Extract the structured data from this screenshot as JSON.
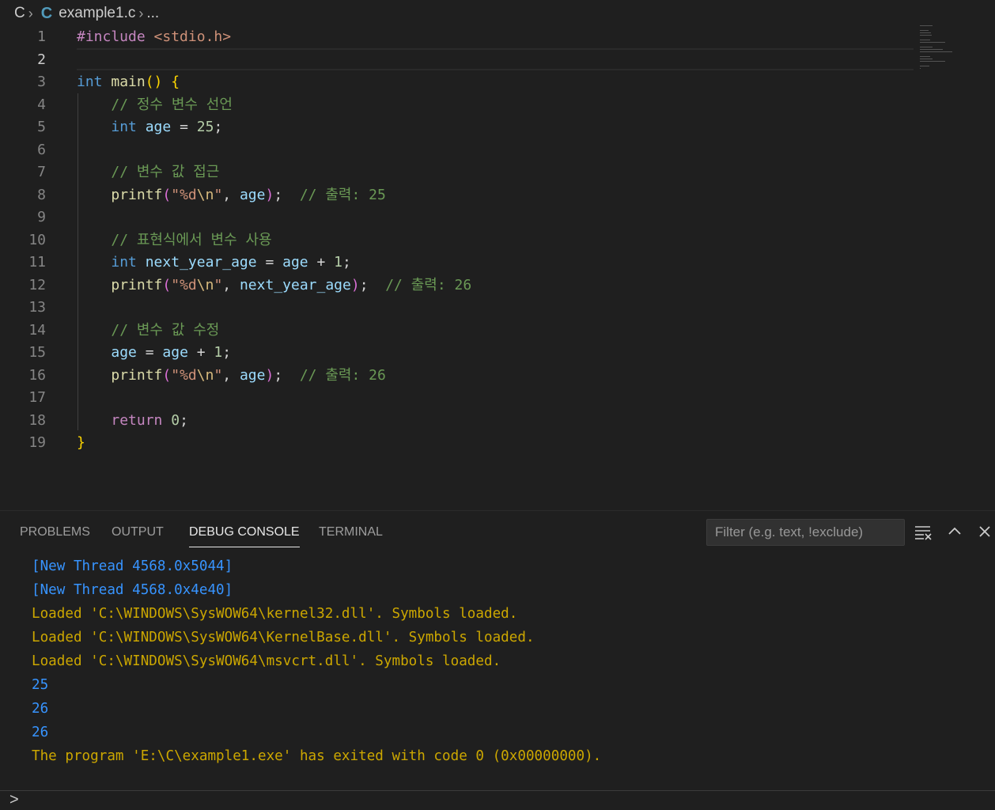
{
  "breadcrumb": {
    "folder": "C",
    "file_icon": "C",
    "file": "example1.c",
    "more": "..."
  },
  "editor": {
    "active_line": 2,
    "lines": [
      {
        "n": "1",
        "tokens": [
          [
            "inc",
            "#include "
          ],
          [
            "hdr",
            "<stdio.h>"
          ]
        ]
      },
      {
        "n": "2",
        "tokens": []
      },
      {
        "n": "3",
        "tokens": [
          [
            "kw",
            "int "
          ],
          [
            "fn",
            "main"
          ],
          [
            "p1",
            "() {"
          ]
        ]
      },
      {
        "n": "4",
        "tokens": [
          [
            "op",
            "    "
          ],
          [
            "cmt",
            "// 정수 변수 선언"
          ]
        ]
      },
      {
        "n": "5",
        "tokens": [
          [
            "op",
            "    "
          ],
          [
            "kw",
            "int "
          ],
          [
            "var",
            "age"
          ],
          [
            "op",
            " = "
          ],
          [
            "num",
            "25"
          ],
          [
            "op",
            ";"
          ]
        ]
      },
      {
        "n": "6",
        "tokens": []
      },
      {
        "n": "7",
        "tokens": [
          [
            "op",
            "    "
          ],
          [
            "cmt",
            "// 변수 값 접근"
          ]
        ]
      },
      {
        "n": "8",
        "tokens": [
          [
            "op",
            "    "
          ],
          [
            "fn",
            "printf"
          ],
          [
            "p2",
            "("
          ],
          [
            "str",
            "\"%d"
          ],
          [
            "esc",
            "\\n"
          ],
          [
            "str",
            "\""
          ],
          [
            "op",
            ", "
          ],
          [
            "var",
            "age"
          ],
          [
            "p2",
            ")"
          ],
          [
            "op",
            ";  "
          ],
          [
            "cmt",
            "// 출력: 25"
          ]
        ]
      },
      {
        "n": "9",
        "tokens": []
      },
      {
        "n": "10",
        "tokens": [
          [
            "op",
            "    "
          ],
          [
            "cmt",
            "// 표현식에서 변수 사용"
          ]
        ]
      },
      {
        "n": "11",
        "tokens": [
          [
            "op",
            "    "
          ],
          [
            "kw",
            "int "
          ],
          [
            "var",
            "next_year_age"
          ],
          [
            "op",
            " = "
          ],
          [
            "var",
            "age"
          ],
          [
            "op",
            " + "
          ],
          [
            "num",
            "1"
          ],
          [
            "op",
            ";"
          ]
        ]
      },
      {
        "n": "12",
        "tokens": [
          [
            "op",
            "    "
          ],
          [
            "fn",
            "printf"
          ],
          [
            "p2",
            "("
          ],
          [
            "str",
            "\"%d"
          ],
          [
            "esc",
            "\\n"
          ],
          [
            "str",
            "\""
          ],
          [
            "op",
            ", "
          ],
          [
            "var",
            "next_year_age"
          ],
          [
            "p2",
            ")"
          ],
          [
            "op",
            ";  "
          ],
          [
            "cmt",
            "// 출력: 26"
          ]
        ]
      },
      {
        "n": "13",
        "tokens": []
      },
      {
        "n": "14",
        "tokens": [
          [
            "op",
            "    "
          ],
          [
            "cmt",
            "// 변수 값 수정"
          ]
        ]
      },
      {
        "n": "15",
        "tokens": [
          [
            "op",
            "    "
          ],
          [
            "var",
            "age"
          ],
          [
            "op",
            " = "
          ],
          [
            "var",
            "age"
          ],
          [
            "op",
            " + "
          ],
          [
            "num",
            "1"
          ],
          [
            "op",
            ";"
          ]
        ]
      },
      {
        "n": "16",
        "tokens": [
          [
            "op",
            "    "
          ],
          [
            "fn",
            "printf"
          ],
          [
            "p2",
            "("
          ],
          [
            "str",
            "\"%d"
          ],
          [
            "esc",
            "\\n"
          ],
          [
            "str",
            "\""
          ],
          [
            "op",
            ", "
          ],
          [
            "var",
            "age"
          ],
          [
            "p2",
            ")"
          ],
          [
            "op",
            ";  "
          ],
          [
            "cmt",
            "// 출력: 26"
          ]
        ]
      },
      {
        "n": "17",
        "tokens": []
      },
      {
        "n": "18",
        "tokens": [
          [
            "op",
            "    "
          ],
          [
            "ctl",
            "return "
          ],
          [
            "num",
            "0"
          ],
          [
            "op",
            ";"
          ]
        ]
      },
      {
        "n": "19",
        "tokens": [
          [
            "p1",
            "}"
          ]
        ]
      }
    ]
  },
  "panel": {
    "tabs": [
      {
        "label": "PROBLEMS",
        "active": false
      },
      {
        "label": "OUTPUT",
        "active": false
      },
      {
        "label": "DEBUG CONSOLE",
        "active": true
      },
      {
        "label": "TERMINAL",
        "active": false
      }
    ],
    "filter_placeholder": "Filter (e.g. text, !exclude)",
    "icons": [
      "collapse-all-icon",
      "chevron-up-icon",
      "close-icon"
    ],
    "console_lines": [
      {
        "text": "[New Thread 4568.0x5044]",
        "color": "blue"
      },
      {
        "text": "[New Thread 4568.0x4e40]",
        "color": "blue"
      },
      {
        "text": "Loaded 'C:\\WINDOWS\\SysWOW64\\kernel32.dll'. Symbols loaded.",
        "color": "yellow"
      },
      {
        "text": "Loaded 'C:\\WINDOWS\\SysWOW64\\KernelBase.dll'. Symbols loaded.",
        "color": "yellow"
      },
      {
        "text": "Loaded 'C:\\WINDOWS\\SysWOW64\\msvcrt.dll'. Symbols loaded.",
        "color": "yellow"
      },
      {
        "text": "25",
        "color": "blue"
      },
      {
        "text": "26",
        "color": "blue"
      },
      {
        "text": "26",
        "color": "blue"
      },
      {
        "text": "The program 'E:\\C\\example1.exe' has exited with code 0 (0x00000000).",
        "color": "yellow"
      }
    ],
    "prompt": ">"
  },
  "colors": {
    "background": "#1f1f1f",
    "console_blue": "#3794ff",
    "console_yellow": "#cca700"
  }
}
